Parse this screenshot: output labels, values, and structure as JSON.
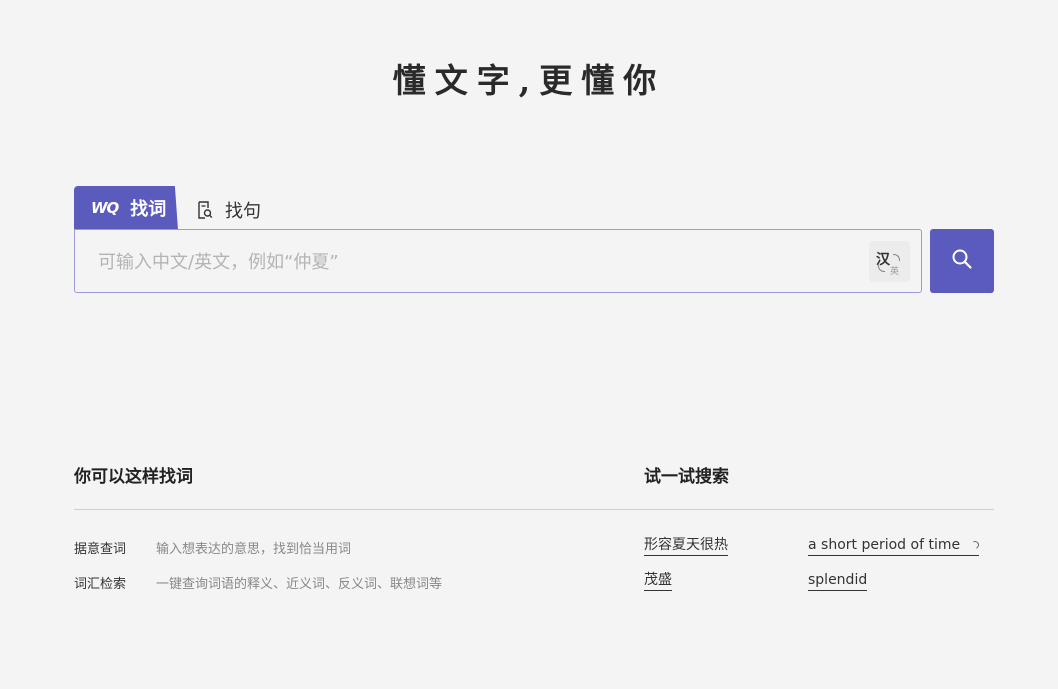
{
  "header": {
    "slogan": "懂文字,更懂你"
  },
  "tabs": {
    "active": {
      "icon": "wq-logo-icon",
      "icon_text": "WQ",
      "label": "找词"
    },
    "inactive": {
      "icon": "document-search-icon",
      "label": "找句"
    }
  },
  "search": {
    "placeholder": "可输入中文/英文，例如“仲夏”",
    "value": "",
    "lang_toggle": {
      "primary": "汉",
      "secondary": "英",
      "icon": "swap-language-icon"
    },
    "button_icon": "search-icon"
  },
  "hints": {
    "title": "你可以这样找词",
    "items": [
      {
        "label": "据意查词",
        "desc": "输入想表达的意思，找到恰当用词"
      },
      {
        "label": "词汇检索",
        "desc": "一键查询词语的释义、近义词、反义词、联想词等"
      }
    ]
  },
  "try": {
    "title": "试一试搜索",
    "items": [
      {
        "text": "形容夏天很热"
      },
      {
        "text": "a short period of time",
        "loading": true
      },
      {
        "text": "茂盛"
      },
      {
        "text": "splendid"
      }
    ]
  },
  "colors": {
    "accent": "#5b5bbd",
    "background": "#f4f4f4",
    "border": "#9a9ad6"
  }
}
